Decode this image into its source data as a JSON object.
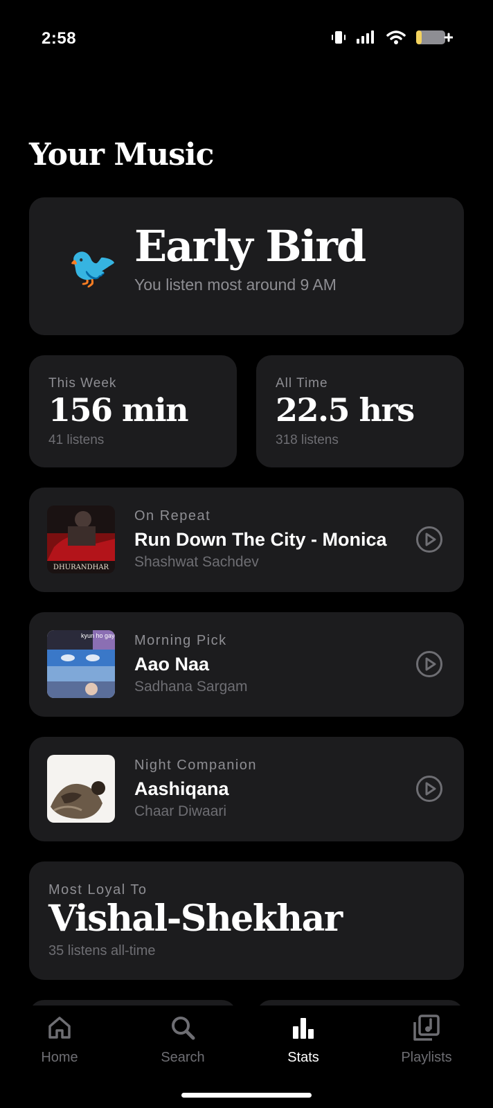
{
  "status_bar": {
    "time": "2:58"
  },
  "page": {
    "title": "Your Music"
  },
  "hero": {
    "emoji": "🐦",
    "title": "Early Bird",
    "subtitle": "You listen most around 9 AM"
  },
  "stats": [
    {
      "label": "This Week",
      "value": "156 min",
      "sub": "41 listens"
    },
    {
      "label": "All Time",
      "value": "22.5 hrs",
      "sub": "318 listens"
    }
  ],
  "tracks": [
    {
      "label": "On Repeat",
      "title": "Run Down The City - Monica",
      "artist": "Shashwat Sachdev",
      "art_text": "DHURANDHAR"
    },
    {
      "label": "Morning Pick",
      "title": "Aao Naa",
      "artist": "Sadhana Sargam",
      "art_text": "kyun ho gaya na"
    },
    {
      "label": "Night Companion",
      "title": "Aashiqana",
      "artist": "Chaar Diwaari"
    }
  ],
  "loyal": {
    "label": "Most Loyal To",
    "name": "Vishal-Shekhar",
    "sub": "35 listens all-time"
  },
  "tabs": [
    {
      "label": "Home",
      "icon": "home-icon",
      "active": false
    },
    {
      "label": "Search",
      "icon": "search-icon",
      "active": false
    },
    {
      "label": "Stats",
      "icon": "bar-chart-icon",
      "active": true
    },
    {
      "label": "Playlists",
      "icon": "playlist-icon",
      "active": false
    }
  ],
  "colors": {
    "background": "#000000",
    "card": "#1c1c1e",
    "muted": "#8e8e93",
    "battery": "#f4d35e"
  }
}
